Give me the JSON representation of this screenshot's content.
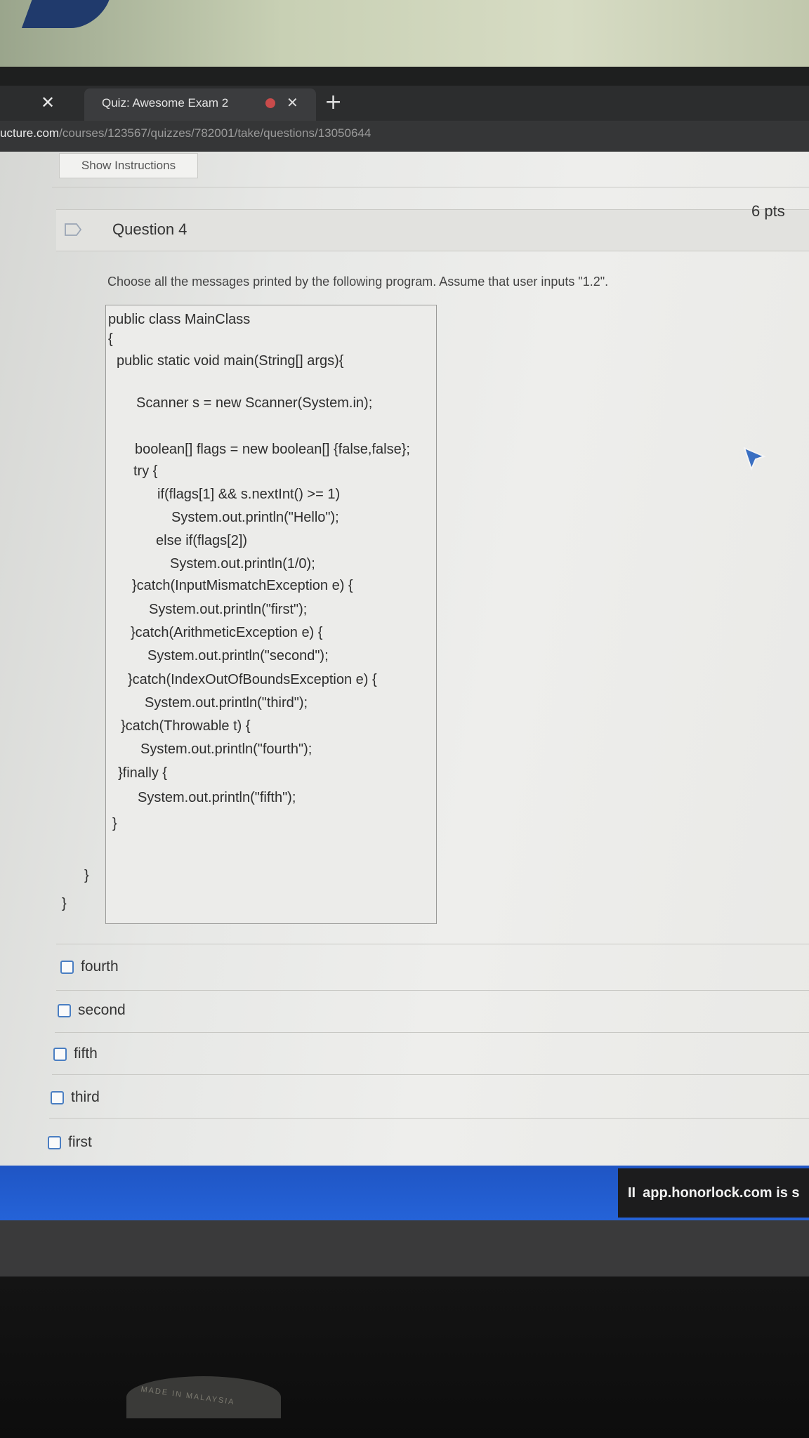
{
  "browser": {
    "tab_title": "Quiz: Awesome Exam 2",
    "url_host": "ucture.com",
    "url_path": "/courses/123567/quizzes/782001/take/questions/13050644"
  },
  "toolbar": {
    "show_instructions_label": "Show Instructions"
  },
  "question": {
    "title": "Question 4",
    "points": "6 pts",
    "prompt": "Choose all the messages printed by the following program. Assume that user inputs \"1.2\".",
    "code_lines": [
      "public class MainClass",
      "{",
      "public static void main(String[] args){",
      "Scanner s = new Scanner(System.in);",
      "boolean[] flags = new boolean[] {false,false};",
      "try {",
      "if(flags[1] && s.nextInt() >= 1)",
      "System.out.println(\"Hello\");",
      "else if(flags[2])",
      "System.out.println(1/0);",
      "}catch(InputMismatchException e) {",
      "System.out.println(\"first\");",
      "}catch(ArithmeticException e) {",
      "System.out.println(\"second\");",
      "}catch(IndexOutOfBoundsException e) {",
      "System.out.println(\"third\");",
      "}catch(Throwable t) {",
      "System.out.println(\"fourth\");",
      "}finally {",
      "System.out.println(\"fifth\");",
      "}",
      "}",
      "}"
    ],
    "options": [
      {
        "label": "fourth",
        "checked": false
      },
      {
        "label": "second",
        "checked": false
      },
      {
        "label": "fifth",
        "checked": false
      },
      {
        "label": "third",
        "checked": false
      },
      {
        "label": "first",
        "checked": false
      }
    ]
  },
  "notice": {
    "bars": "II",
    "text": "app.honorlock.com is s"
  },
  "stand": {
    "text": "MADE IN MALAYSIA"
  },
  "icons": {
    "close": "close-icon",
    "new_tab": "plus-icon",
    "bookmark": "bookmark-icon",
    "cursor": "mouse-cursor-icon"
  },
  "colors": {
    "accent_blue": "#2563d8",
    "checkbox_border": "#4a7ec2",
    "tab_dot": "#c94b4b"
  }
}
